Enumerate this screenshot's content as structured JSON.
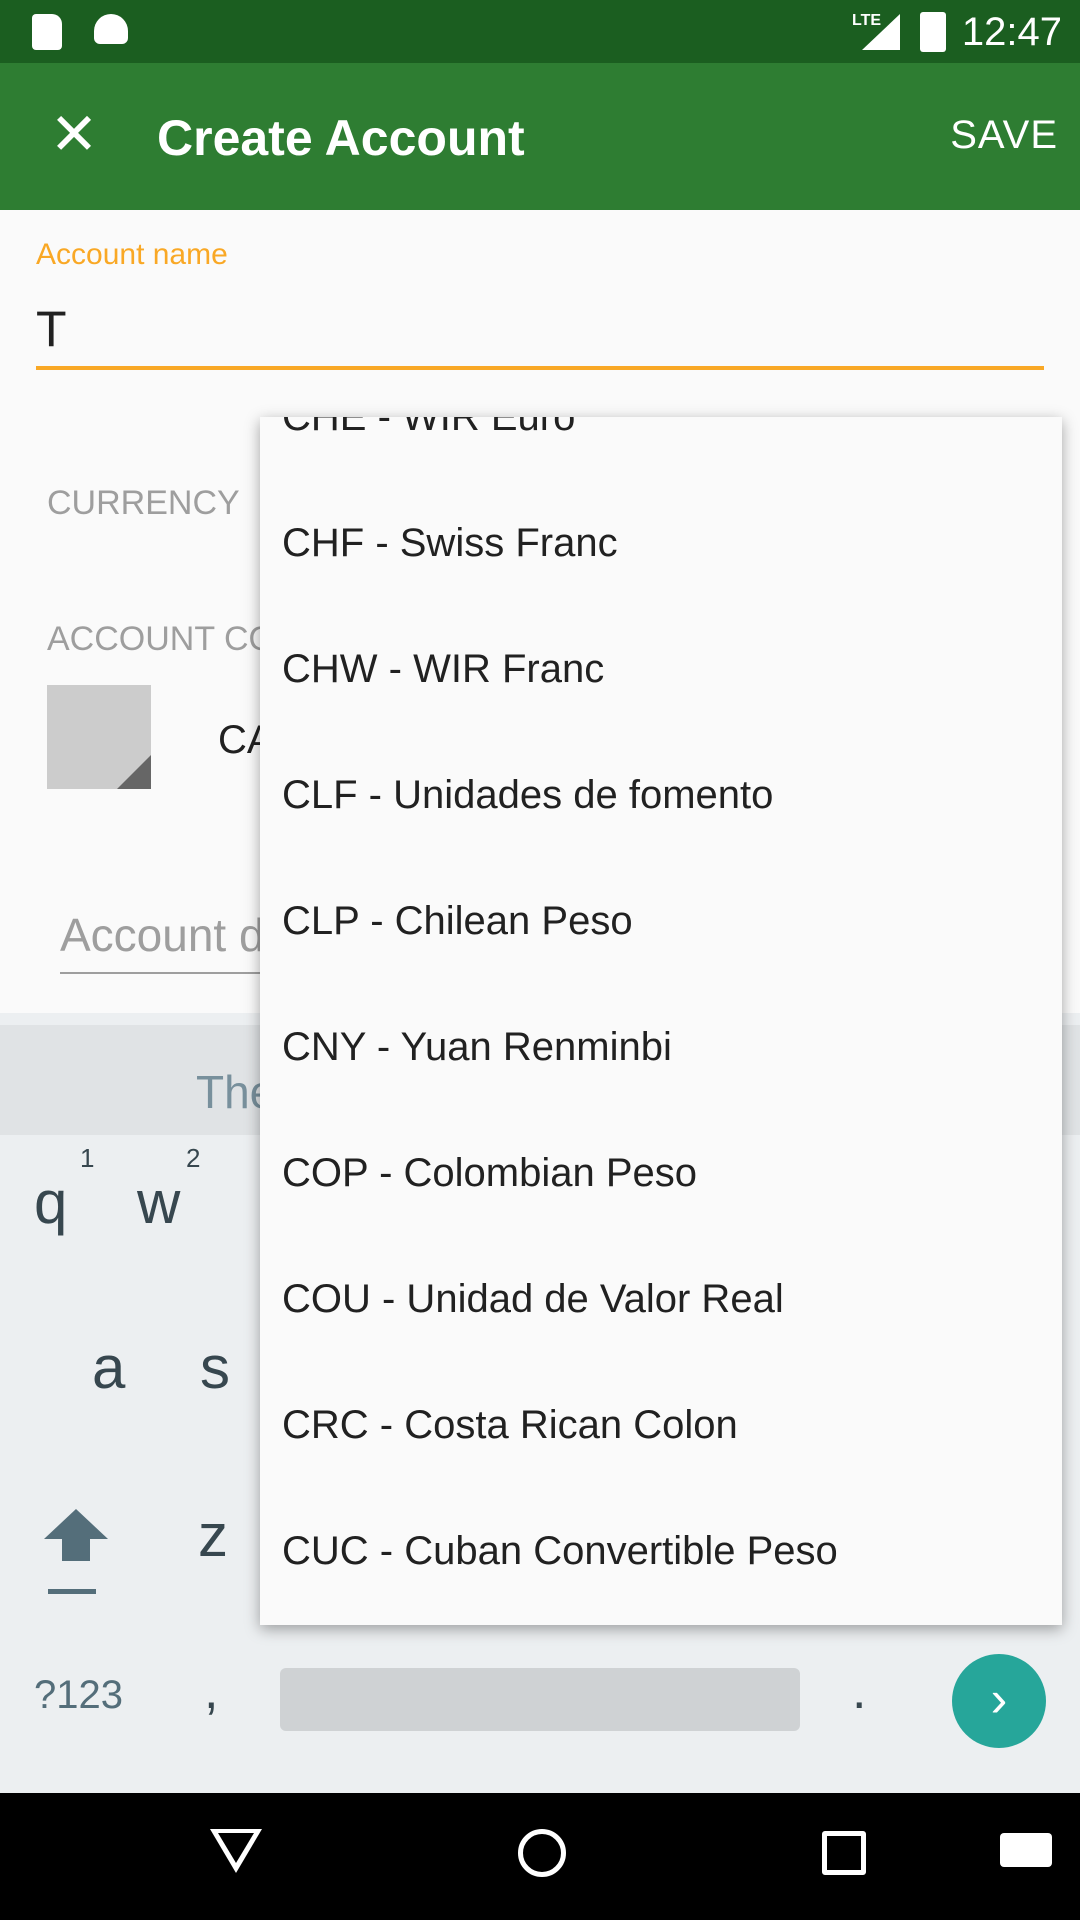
{
  "status_bar": {
    "time": "12:47",
    "lte_label": "LTE",
    "icons": [
      "sd-card-icon",
      "android-icon",
      "signal-icon",
      "battery-charging-icon"
    ]
  },
  "app_bar": {
    "title": "Create Account",
    "save_label": "SAVE",
    "close_icon": "close-icon"
  },
  "form": {
    "name_label": "Account name",
    "name_value": "T",
    "currency_label": "CURRENCY",
    "color_label": "ACCOUNT CO",
    "code_value": "CA",
    "desc_placeholder": "Account d"
  },
  "colors": {
    "status_bar": "#1b5e20",
    "app_bar": "#2e7d32",
    "accent": "#f9a825",
    "swatch": "#cccccc",
    "keyboard_action": "#26a69a"
  },
  "keyboard": {
    "suggestion": "The",
    "row1": [
      {
        "key": "q",
        "hint": "1"
      },
      {
        "key": "w",
        "hint": "2"
      }
    ],
    "row2": [
      "a",
      "s"
    ],
    "row3": [
      "z"
    ],
    "symbols_label": "?123",
    "comma_label": ",",
    "period_label": ".",
    "next_label": "›"
  },
  "currency_dropdown": {
    "items": [
      "CHE - WIR Euro",
      "CHF - Swiss Franc",
      "CHW - WIR Franc",
      "CLF - Unidades de fomento",
      "CLP - Chilean Peso",
      "CNY - Yuan Renminbi",
      "COP - Colombian Peso",
      "COU - Unidad de Valor Real",
      "CRC - Costa Rican Colon",
      "CUC - Cuban Convertible Peso"
    ]
  },
  "nav_bar": {
    "icons": [
      "back-icon",
      "home-icon",
      "recents-icon",
      "keyboard-switch-icon"
    ]
  }
}
